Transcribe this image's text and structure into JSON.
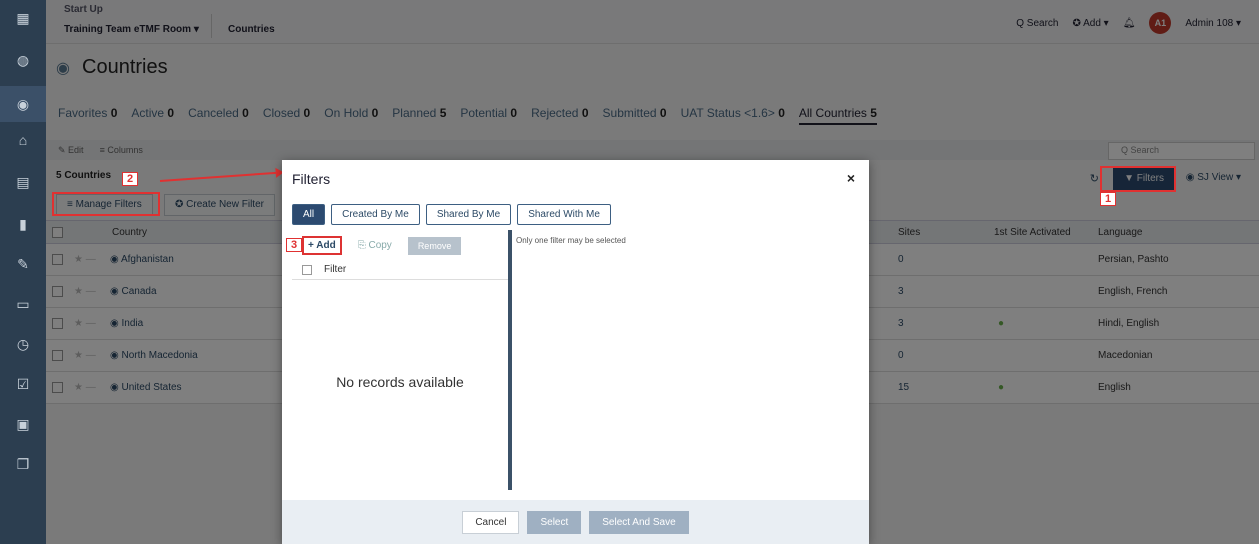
{
  "nav": {
    "icons": [
      "apps-icon",
      "dashboard-icon",
      "globe-icon",
      "bank-icon",
      "building-icon",
      "document-icon",
      "edit-icon",
      "id-card-icon",
      "clock-icon",
      "checkbox-icon",
      "binder-icon",
      "copy-icon"
    ]
  },
  "topbar": {
    "startup": "Start Up",
    "room": "Training Team eTMF Room ▾",
    "countries": "Countries",
    "search": "Q Search",
    "add": "✪ Add ▾",
    "avatar": "A1",
    "user": "Admin 108 ▾"
  },
  "page": {
    "title": "Countries",
    "tabs": [
      {
        "label": "Favorites",
        "count": "0"
      },
      {
        "label": "Active",
        "count": "0"
      },
      {
        "label": "Canceled",
        "count": "0"
      },
      {
        "label": "Closed",
        "count": "0"
      },
      {
        "label": "On Hold",
        "count": "0"
      },
      {
        "label": "Planned",
        "count": "5"
      },
      {
        "label": "Potential",
        "count": "0"
      },
      {
        "label": "Rejected",
        "count": "0"
      },
      {
        "label": "Submitted",
        "count": "0"
      },
      {
        "label": "UAT Status <1.6>",
        "count": "0"
      },
      {
        "label": "All Countries",
        "count": "5"
      }
    ],
    "toolbar": {
      "edit": "✎ Edit",
      "columns": "≡ Columns"
    },
    "search_placeholder": "Q Search",
    "count": "5 Countries",
    "manage_filters": "≡ Manage Filters",
    "create_filter": "✪ Create New Filter",
    "filters_btn": "▼ Filters",
    "sj_view": "◉ SJ View ▾",
    "columns": {
      "country": "Country",
      "sites": "Sites",
      "first_site": "1st Site Activated",
      "language": "Language"
    },
    "rows": [
      {
        "country": "Afghanistan",
        "sites": "0",
        "activated": "",
        "language": "Persian, Pashto"
      },
      {
        "country": "Canada",
        "sites": "3",
        "activated": "",
        "language": "English, French"
      },
      {
        "country": "India",
        "sites": "3",
        "activated": "●",
        "language": "Hindi, English"
      },
      {
        "country": "North Macedonia",
        "sites": "0",
        "activated": "",
        "language": "Macedonian"
      },
      {
        "country": "United States",
        "sites": "15",
        "activated": "●",
        "language": "English"
      }
    ]
  },
  "modal": {
    "title": "Filters",
    "close": "×",
    "tabs": [
      "All",
      "Created By Me",
      "Shared By Me",
      "Shared With Me"
    ],
    "add": "+ Add",
    "copy": "⎘ Copy",
    "remove": "Remove",
    "filter_header": "Filter",
    "empty": "No records available",
    "note": "Only one filter may be selected",
    "cancel": "Cancel",
    "select": "Select",
    "select_save": "Select And Save"
  },
  "annotations": [
    "1",
    "2",
    "3"
  ]
}
